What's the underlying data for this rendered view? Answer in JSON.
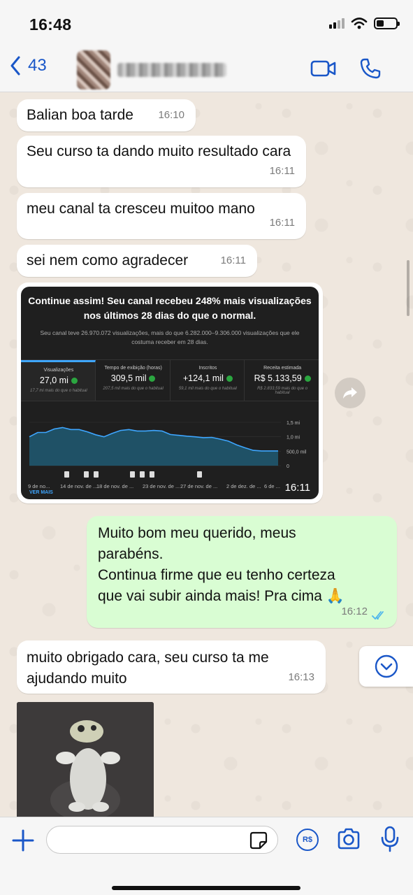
{
  "status_bar": {
    "time": "16:48"
  },
  "header": {
    "back_count": "43"
  },
  "messages": [
    {
      "text": "Balian boa tarde",
      "time": "16:10"
    },
    {
      "text": "Seu curso ta dando muito resultado cara",
      "time": "16:11"
    },
    {
      "text": "meu canal ta cresceu muitoo mano",
      "time": "16:11"
    },
    {
      "text": "sei nem como agradecer",
      "time": "16:11"
    },
    {
      "line1": "Muito bom meu querido, meus",
      "line2": "parabéns.",
      "line3": "Continua firme que eu tenho certeza",
      "line4": "que vai subir ainda mais! Pra cima",
      "emoji": "🙏",
      "time": "16:12",
      "status": "read"
    },
    {
      "text": "muito obrigado cara, seu curso ta me ajudando muito",
      "time": "16:13"
    }
  ],
  "screenshot_message": {
    "time": "16:11",
    "headline": "Continue assim! Seu canal recebeu 248% mais visualizações nos últimos 28 dias do que o normal.",
    "subtitle": "Seu canal teve 26.970.072 visualizações, mais do que 6.282.000–9.306.000 visualizações que ele costuma receber em 28 dias.",
    "tabs": [
      {
        "label": "Visualizações",
        "value": "27,0 mi",
        "note": "17,7 mi mais do que o habitual"
      },
      {
        "label": "Tempo de exibição (horas)",
        "value": "309,5 mil",
        "note": "207,5 mil mais do que o habitual"
      },
      {
        "label": "Inscritos",
        "value": "+124,1 mil",
        "note": "59,1 mil mais do que o habitual"
      },
      {
        "label": "Receita estimada",
        "value": "R$ 5.133,59",
        "note": "R$ 2.833,59 mais do que o habitual"
      }
    ],
    "chart": {
      "y_ticks": [
        "1,5 mi",
        "1,0 mi",
        "500,0 mil",
        "0"
      ],
      "x_labels": [
        "9 de no...",
        "14 de nov. de ...",
        "18 de nov. de ...",
        "23 de nov. de ...",
        "27 de nov. de ...",
        "2 de dez. de ...",
        "6 de ..."
      ],
      "values": [
        1.0,
        1.15,
        1.15,
        1.27,
        1.32,
        1.25,
        1.25,
        1.17,
        1.07,
        1.0,
        1.12,
        1.22,
        1.25,
        1.2,
        1.2,
        1.22,
        1.2,
        1.08,
        1.05,
        1.02,
        1.0,
        0.97,
        0.98,
        0.92,
        0.85,
        0.72,
        0.62,
        0.53,
        0.51,
        0.51,
        0.51
      ],
      "line_color": "#3ea6ff",
      "fill_color": "#1f5166"
    },
    "see_more": "VER MAIS"
  },
  "composer": {
    "placeholder": "",
    "pay_label": "R$"
  },
  "colors": {
    "accent": "#1a57c8",
    "outgoing_bubble": "#d9fdd3",
    "read_ticks": "#4fb6ec"
  }
}
